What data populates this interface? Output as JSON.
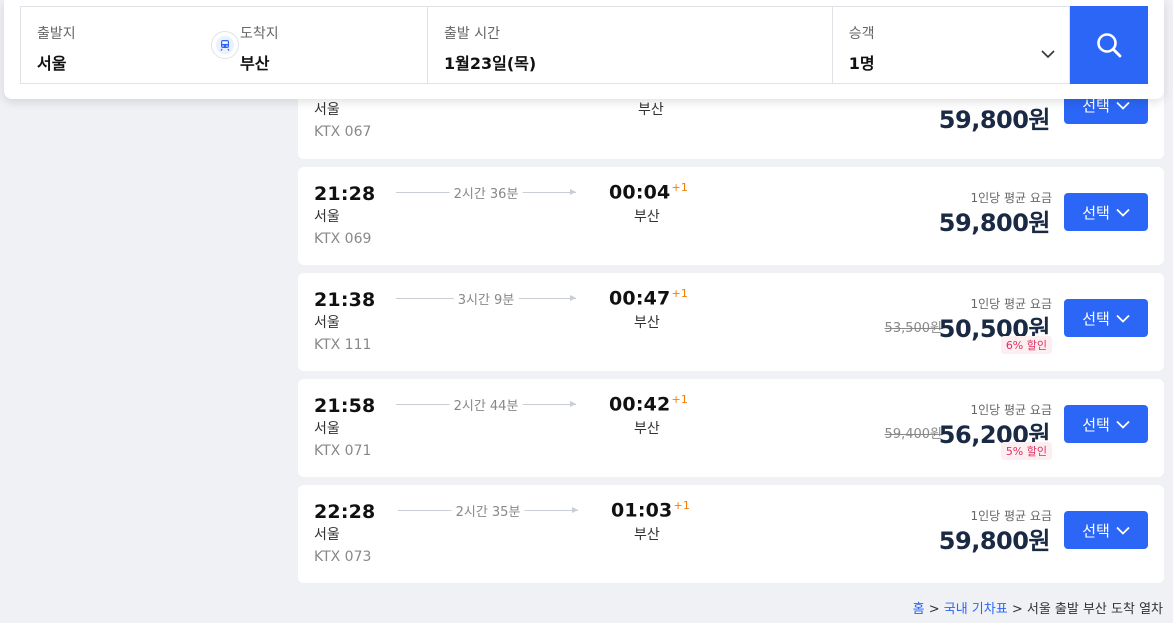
{
  "search": {
    "origin_label": "출발지",
    "origin_value": "서울",
    "dest_label": "도착지",
    "dest_value": "부산",
    "date_label": "출발 시간",
    "date_value": "1월23일(목)",
    "pax_label": "승객",
    "pax_value": "1명"
  },
  "partial_row": {
    "dep_station": "서울",
    "train_no": "KTX 067",
    "arr_station": "부산",
    "price": "59,800원",
    "select_label": "선택"
  },
  "trains": [
    {
      "dep_time": "21:28",
      "dep_station": "서울",
      "train_no": "KTX 069",
      "duration": "2시간 36분",
      "arr_time": "00:04",
      "plus_day": "+1",
      "arr_station": "부산",
      "price_label": "1인당 평균 요금",
      "price": "59,800원",
      "original_price": "",
      "discount": "",
      "select_label": "선택"
    },
    {
      "dep_time": "21:38",
      "dep_station": "서울",
      "train_no": "KTX 111",
      "duration": "3시간 9분",
      "arr_time": "00:47",
      "plus_day": "+1",
      "arr_station": "부산",
      "price_label": "1인당 평균 요금",
      "price": "50,500원",
      "original_price": "53,500원",
      "discount": "6% 할인",
      "select_label": "선택"
    },
    {
      "dep_time": "21:58",
      "dep_station": "서울",
      "train_no": "KTX 071",
      "duration": "2시간 44분",
      "arr_time": "00:42",
      "plus_day": "+1",
      "arr_station": "부산",
      "price_label": "1인당 평균 요금",
      "price": "56,200원",
      "original_price": "59,400원",
      "discount": "5% 할인",
      "select_label": "선택"
    },
    {
      "dep_time": "22:28",
      "dep_station": "서울",
      "train_no": "KTX 073",
      "duration": "2시간 35분",
      "arr_time": "01:03",
      "plus_day": "+1",
      "arr_station": "부산",
      "price_label": "1인당 평균 요금",
      "price": "59,800원",
      "original_price": "",
      "discount": "",
      "select_label": "선택"
    }
  ],
  "breadcrumb": {
    "home": "홈",
    "sep": ">",
    "domestic": "국내 기차표",
    "current": "서울 출발 부산 도착 열차"
  },
  "colors": {
    "accent": "#2b66f6",
    "discount": "#e02e60",
    "plus_day": "#f27d0a"
  }
}
